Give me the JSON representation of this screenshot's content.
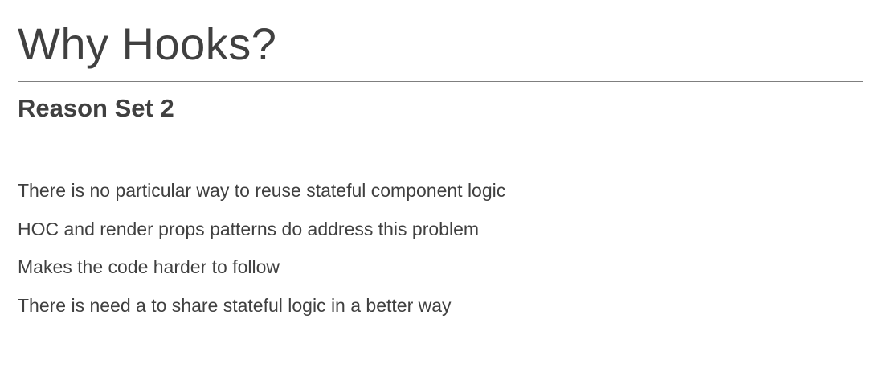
{
  "slide": {
    "title": "Why Hooks?",
    "subtitle": "Reason Set 2",
    "bullets": [
      "There is no particular way to reuse stateful component logic",
      "HOC and render props patterns do address this problem",
      "Makes the code harder to follow",
      "There is need a to share stateful logic in a better way"
    ]
  },
  "colors": {
    "text": "#404040",
    "rule": "#7f7f7f",
    "background": "#ffffff"
  }
}
